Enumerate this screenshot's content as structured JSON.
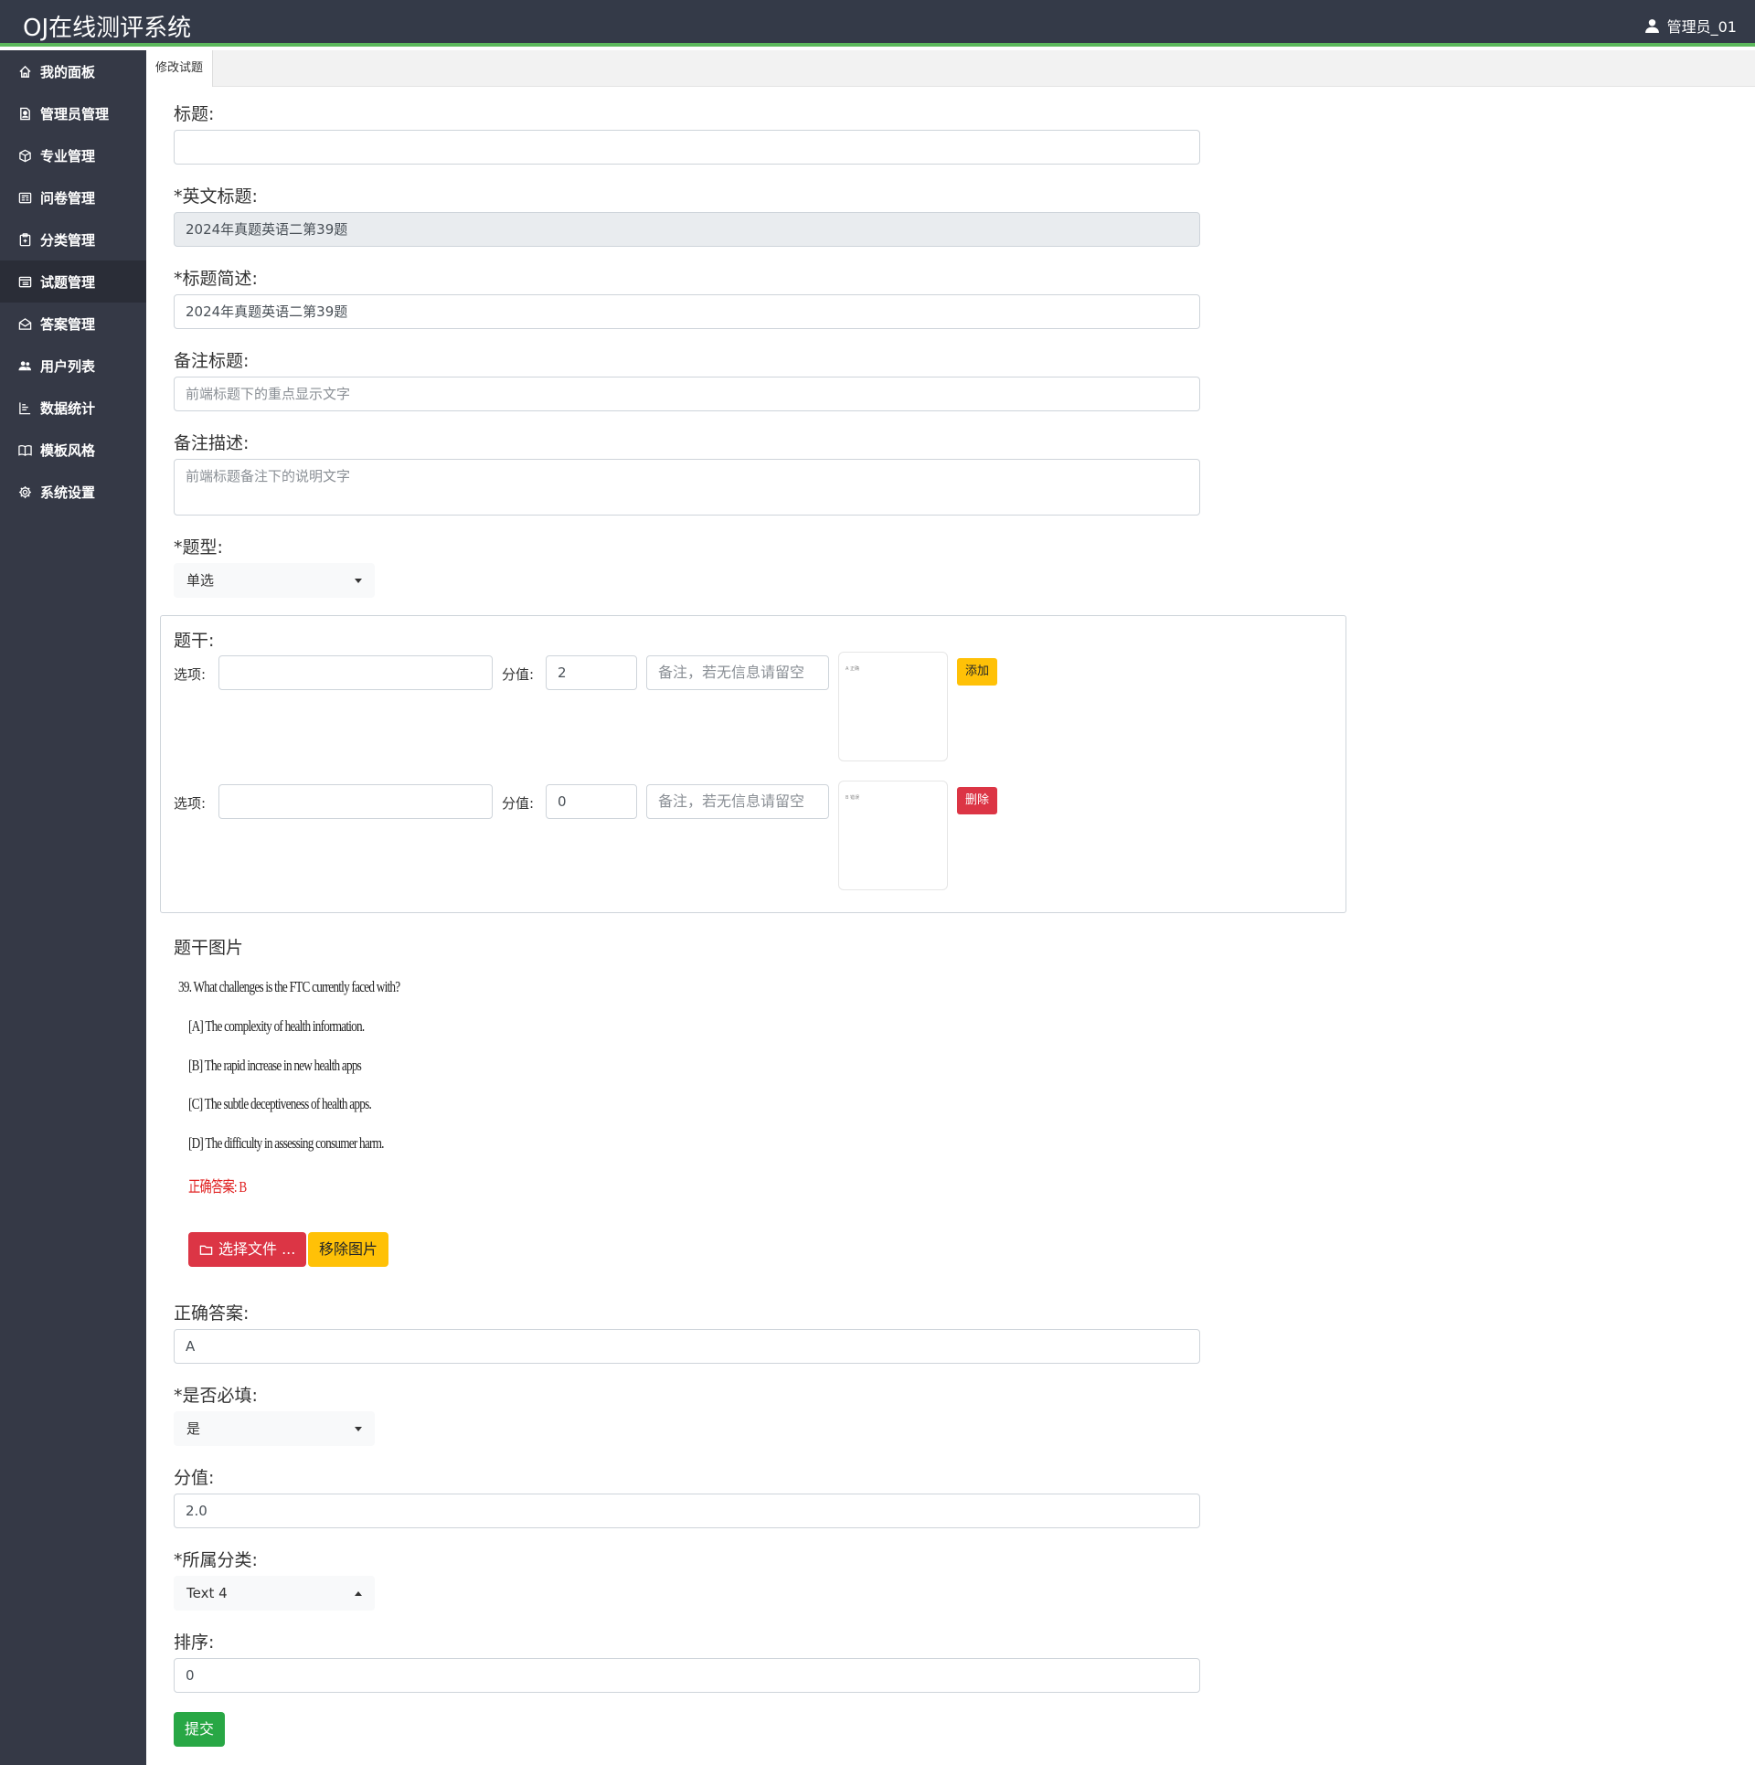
{
  "app": {
    "title": "OJ在线测评系统",
    "user": "管理员_01"
  },
  "sidebar": {
    "items": [
      {
        "label": "我的面板",
        "icon": "home-icon"
      },
      {
        "label": "管理员管理",
        "icon": "file-person-icon"
      },
      {
        "label": "专业管理",
        "icon": "box-icon"
      },
      {
        "label": "问卷管理",
        "icon": "newspaper-icon"
      },
      {
        "label": "分类管理",
        "icon": "clipboard-icon"
      },
      {
        "label": "试题管理",
        "icon": "card-list-icon"
      },
      {
        "label": "答案管理",
        "icon": "envelope-open-icon"
      },
      {
        "label": "用户列表",
        "icon": "people-icon"
      },
      {
        "label": "数据统计",
        "icon": "bar-chart-icon"
      },
      {
        "label": "模板风格",
        "icon": "book-icon"
      },
      {
        "label": "系统设置",
        "icon": "gear-icon"
      }
    ]
  },
  "tab": {
    "label": "修改试题"
  },
  "form": {
    "title": {
      "label": "标题:",
      "value": ""
    },
    "en_title": {
      "label": "*英文标题:",
      "value": "2024年真题英语二第39题"
    },
    "summary": {
      "label": "*标题简述:",
      "value": "2024年真题英语二第39题"
    },
    "note_title": {
      "label": "备注标题:",
      "placeholder": "前端标题下的重点显示文字"
    },
    "note_desc": {
      "label": "备注描述:",
      "placeholder": "前端标题备注下的说明文字"
    },
    "qtype": {
      "label": "*题型:",
      "value": "单选"
    },
    "stem": {
      "label": "题干:",
      "options": [
        {
          "opt_label": "选项:",
          "value": "",
          "score_label": "分值:",
          "score": "2",
          "note_placeholder": "备注，若无信息请留空",
          "thumb_text": "A 正确",
          "action": "添加"
        },
        {
          "opt_label": "选项:",
          "value": "",
          "score_label": "分值:",
          "score": "0",
          "note_placeholder": "备注，若无信息请留空",
          "thumb_text": "B 错误",
          "action": "删除"
        }
      ]
    },
    "stem_image": {
      "label": "题干图片",
      "lines": [
        "39. What challenges is the FTC currently faced with?",
        "[A] The complexity of health information.",
        "[B] The rapid increase in new health apps",
        "[C] The subtle deceptiveness of health apps.",
        "[D] The difficulty in assessing consumer harm.",
        "正确答案: B"
      ],
      "choose_btn": "选择文件 ...",
      "remove_btn": "移除图片"
    },
    "answer": {
      "label": "正确答案:",
      "value": "A"
    },
    "required": {
      "label": "*是否必填:",
      "value": "是"
    },
    "score": {
      "label": "分值:",
      "value": "2.0"
    },
    "category": {
      "label": "*所属分类:",
      "value": "Text 4"
    },
    "sort": {
      "label": "排序:",
      "value": "0"
    },
    "submit": "提交"
  }
}
